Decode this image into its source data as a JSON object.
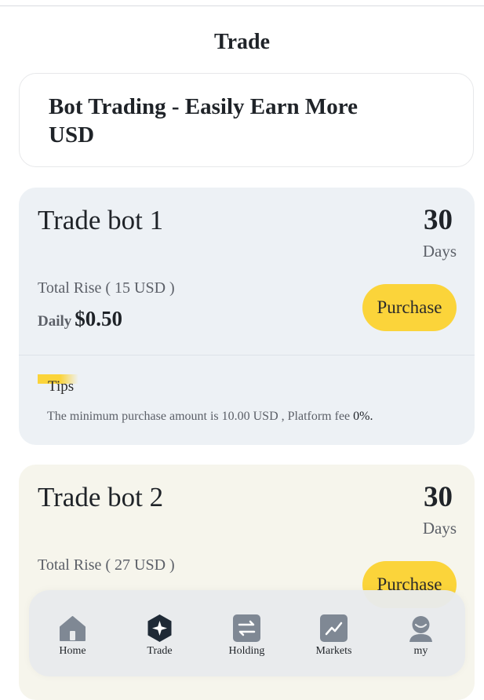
{
  "header": {
    "title": "Trade"
  },
  "hero": {
    "title": "Bot Trading - Easily Earn More USD"
  },
  "bots": [
    {
      "name": "Trade bot 1",
      "days": "30",
      "days_label": "Days",
      "total_rise": "Total Rise ( 15 USD )",
      "daily_label": "Daily",
      "daily_value": "$0.50",
      "purchase_label": "Purchase",
      "tips_label": "Tips",
      "tips_text": "The minimum purchase amount is 10.00 USD , Platform fee ",
      "tips_fee": "0%.",
      "bg": "#edf1f5"
    },
    {
      "name": "Trade bot 2",
      "days": "30",
      "days_label": "Days",
      "total_rise": "Total Rise ( 27 USD )",
      "purchase_label": "Purchase",
      "bg": "#f6f5ec"
    }
  ],
  "nav": {
    "items": [
      {
        "label": "Home",
        "icon": "home-icon"
      },
      {
        "label": "Trade",
        "icon": "trade-icon",
        "active": true
      },
      {
        "label": "Holding",
        "icon": "exchange-icon"
      },
      {
        "label": "Markets",
        "icon": "chart-line-icon"
      },
      {
        "label": "my",
        "icon": "user-icon"
      }
    ]
  },
  "colors": {
    "accent": "#fbd43a",
    "icon_inactive": "#7f8894",
    "icon_active": "#1f2a36"
  }
}
